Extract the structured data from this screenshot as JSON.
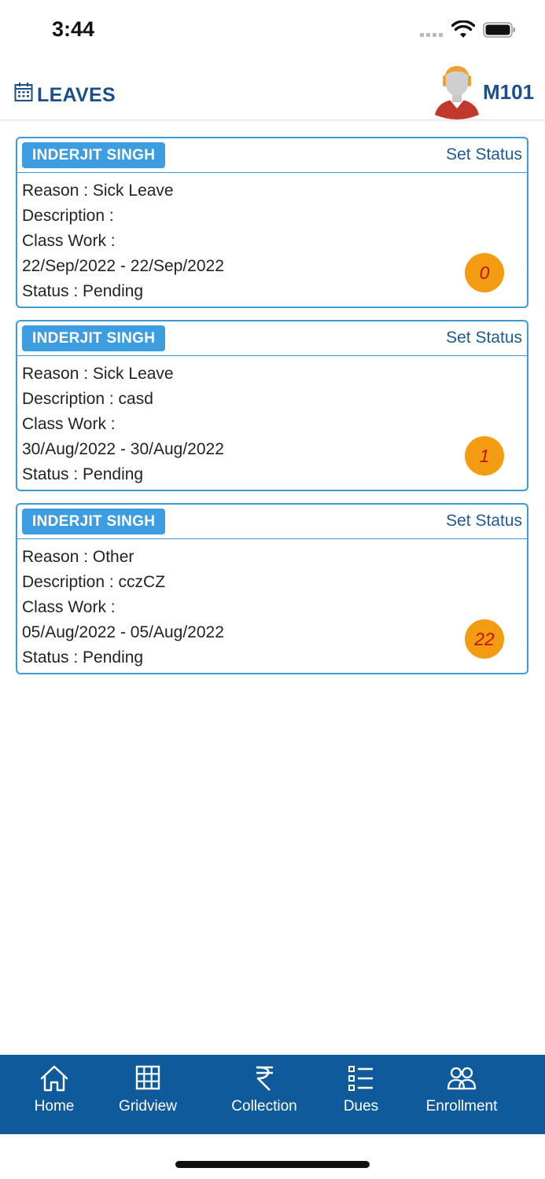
{
  "status_bar": {
    "time": "3:44"
  },
  "header": {
    "title": "LEAVES",
    "user_code": "M101"
  },
  "leaves": [
    {
      "name": "INDERJIT SINGH",
      "action": "Set Status",
      "reason": "Reason : Sick Leave",
      "description": "Description : ",
      "class_work": "Class Work : ",
      "dates": "22/Sep/2022 - 22/Sep/2022",
      "status": "Status : Pending",
      "count": "0"
    },
    {
      "name": "INDERJIT SINGH",
      "action": "Set Status",
      "reason": "Reason : Sick Leave",
      "description": "Description : casd",
      "class_work": "Class Work : ",
      "dates": "30/Aug/2022 - 30/Aug/2022",
      "status": "Status : Pending",
      "count": "1"
    },
    {
      "name": "INDERJIT SINGH",
      "action": "Set Status",
      "reason": "Reason : Other",
      "description": "Description : cczCZ",
      "class_work": "Class Work : ",
      "dates": "05/Aug/2022 - 05/Aug/2022",
      "status": "Status : Pending",
      "count": "22"
    }
  ],
  "bottom_nav": [
    {
      "label": "Home",
      "icon": "home-icon"
    },
    {
      "label": "Gridview",
      "icon": "grid-icon"
    },
    {
      "label": "Collection",
      "icon": "rupee-icon"
    },
    {
      "label": "Dues",
      "icon": "list-icon"
    },
    {
      "label": "Enrollment",
      "icon": "users-icon"
    }
  ],
  "colors": {
    "primary": "#0f5a9a",
    "card_border": "#3a9bd9",
    "badge": "#3c9ee0",
    "count_bubble": "#f39c12",
    "count_text": "#c0141c",
    "title": "#1a4f8c"
  }
}
